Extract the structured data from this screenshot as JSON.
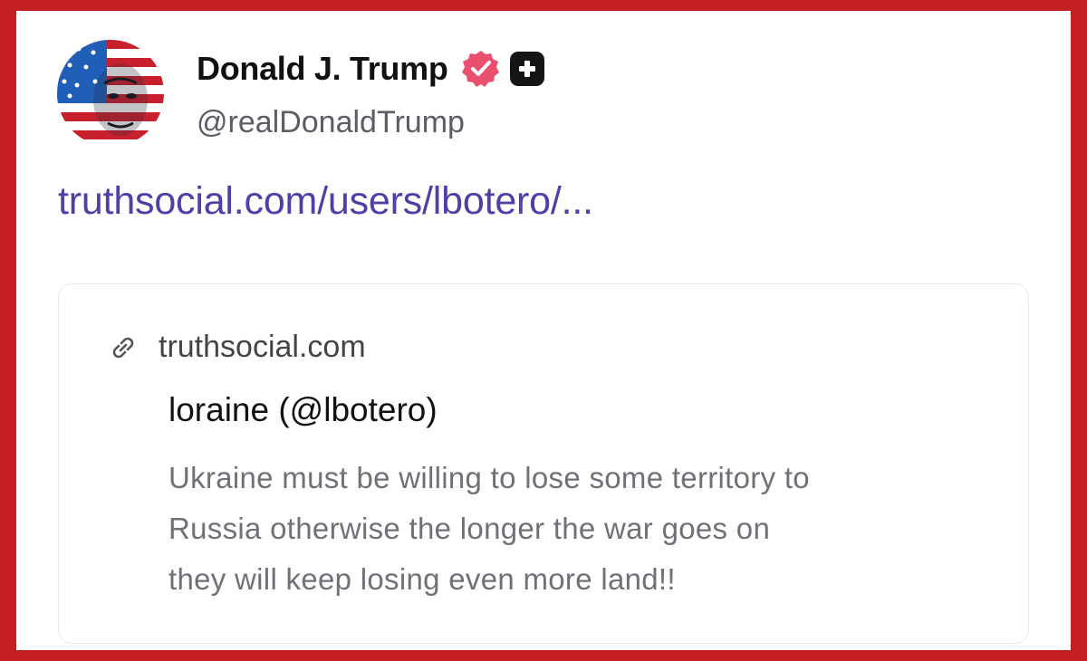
{
  "post": {
    "author": {
      "display_name": "Donald J. Trump",
      "handle": "@realDonaldTrump",
      "avatar_icon": "flag-portrait-avatar",
      "verified_icon": "verified-badge-icon",
      "plus_icon": "plus-badge-icon"
    },
    "link_text": "truthsocial.com/users/lbotero/...",
    "link_color": "#4f3fa6"
  },
  "link_card": {
    "icon": "link-icon",
    "domain": "truthsocial.com",
    "title": "loraine (@lbotero)",
    "description_lines": [
      "Ukraine must be willing to lose some territory to",
      "Russia otherwise the longer the war goes on",
      "they will keep losing even more land!!"
    ]
  },
  "colors": {
    "border_frame": "#c31e22",
    "verified_badge": "#e94f6e",
    "plus_badge": "#151515"
  }
}
